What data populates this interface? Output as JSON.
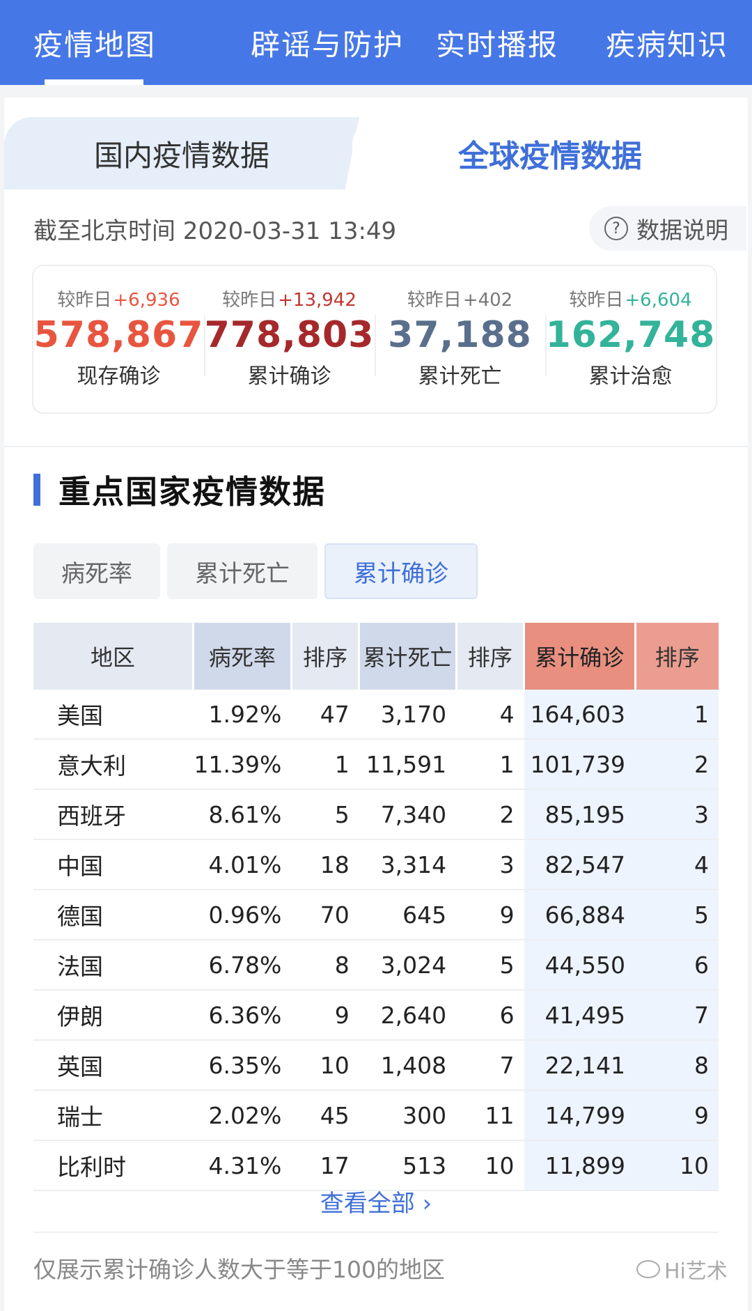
{
  "nav": {
    "tabs": [
      "疫情地图",
      "辟谣与防护",
      "实时播报",
      "疾病知识"
    ]
  },
  "scope": {
    "domestic": "国内疫情数据",
    "global": "全球疫情数据"
  },
  "timestamp": "截至北京时间 2020-03-31 13:49",
  "info_label": "数据说明",
  "stats": [
    {
      "delta_label": "较昨日",
      "delta": "+6,936",
      "value": "578,867",
      "label": "现存确诊",
      "color": "#e8553e",
      "delta_color": "#e8553e"
    },
    {
      "delta_label": "较昨日",
      "delta": "+13,942",
      "value": "778,803",
      "label": "累计确诊",
      "color": "#a5282a",
      "delta_color": "#c2362f"
    },
    {
      "delta_label": "较昨日",
      "delta": "+402",
      "value": "37,188",
      "label": "累计死亡",
      "color": "#5a6f8c",
      "delta_color": "#777777"
    },
    {
      "delta_label": "较昨日",
      "delta": "+6,604",
      "value": "162,748",
      "label": "累计治愈",
      "color": "#33b39a",
      "delta_color": "#33b39a"
    }
  ],
  "section_title": "重点国家疫情数据",
  "filters": [
    "病死率",
    "累计死亡",
    "累计确诊"
  ],
  "table": {
    "headers": [
      "地区",
      "病死率",
      "排序",
      "累计死亡",
      "排序",
      "累计确诊",
      "排序"
    ],
    "rows": [
      [
        "美国",
        "1.92%",
        "47",
        "3,170",
        "4",
        "164,603",
        "1"
      ],
      [
        "意大利",
        "11.39%",
        "1",
        "11,591",
        "1",
        "101,739",
        "2"
      ],
      [
        "西班牙",
        "8.61%",
        "5",
        "7,340",
        "2",
        "85,195",
        "3"
      ],
      [
        "中国",
        "4.01%",
        "18",
        "3,314",
        "3",
        "82,547",
        "4"
      ],
      [
        "德国",
        "0.96%",
        "70",
        "645",
        "9",
        "66,884",
        "5"
      ],
      [
        "法国",
        "6.78%",
        "8",
        "3,024",
        "5",
        "44,550",
        "6"
      ],
      [
        "伊朗",
        "6.36%",
        "9",
        "2,640",
        "6",
        "41,495",
        "7"
      ],
      [
        "英国",
        "6.35%",
        "10",
        "1,408",
        "7",
        "22,141",
        "8"
      ],
      [
        "瑞士",
        "2.02%",
        "45",
        "300",
        "11",
        "14,799",
        "9"
      ],
      [
        "比利时",
        "4.31%",
        "17",
        "513",
        "10",
        "11,899",
        "10"
      ]
    ]
  },
  "view_all": "查看全部 ›",
  "footnote": "仅展示累计确诊人数大于等于100的地区",
  "watermark": "Hi艺术"
}
